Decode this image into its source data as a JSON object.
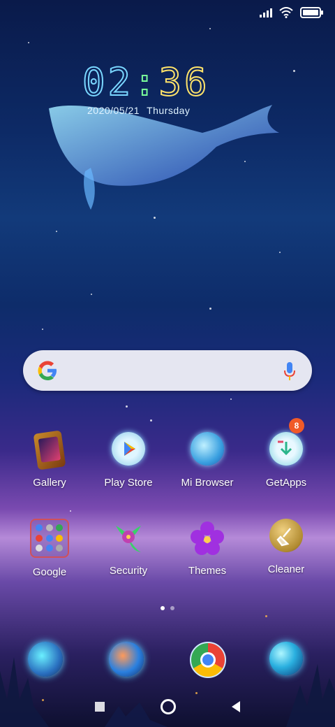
{
  "status_bar": {
    "icons": [
      "signal-icon",
      "wifi-icon",
      "battery-icon"
    ]
  },
  "clock": {
    "hours": "02",
    "minutes": "36"
  },
  "date": {
    "date": "2020/05/21",
    "weekday": "Thursday"
  },
  "search": {
    "logo": "google-g-icon",
    "mic": "mic-icon"
  },
  "apps_row1": [
    {
      "label": "Gallery"
    },
    {
      "label": "Play Store"
    },
    {
      "label": "Mi Browser"
    },
    {
      "label": "GetApps",
      "badge": "8"
    }
  ],
  "apps_row2": [
    {
      "label": "Google"
    },
    {
      "label": "Security"
    },
    {
      "label": "Themes"
    },
    {
      "label": "Cleaner"
    }
  ],
  "page_indicator": {
    "pages": 2,
    "current": 1
  },
  "dock": [
    "fish-app-icon",
    "koi-app-icon",
    "chrome-icon",
    "sphere-app-icon"
  ],
  "nav": [
    "recents-button",
    "home-button",
    "back-button"
  ],
  "colors": {
    "accent_badge": "#f05a28",
    "search_bg": "#f0f0f8"
  }
}
